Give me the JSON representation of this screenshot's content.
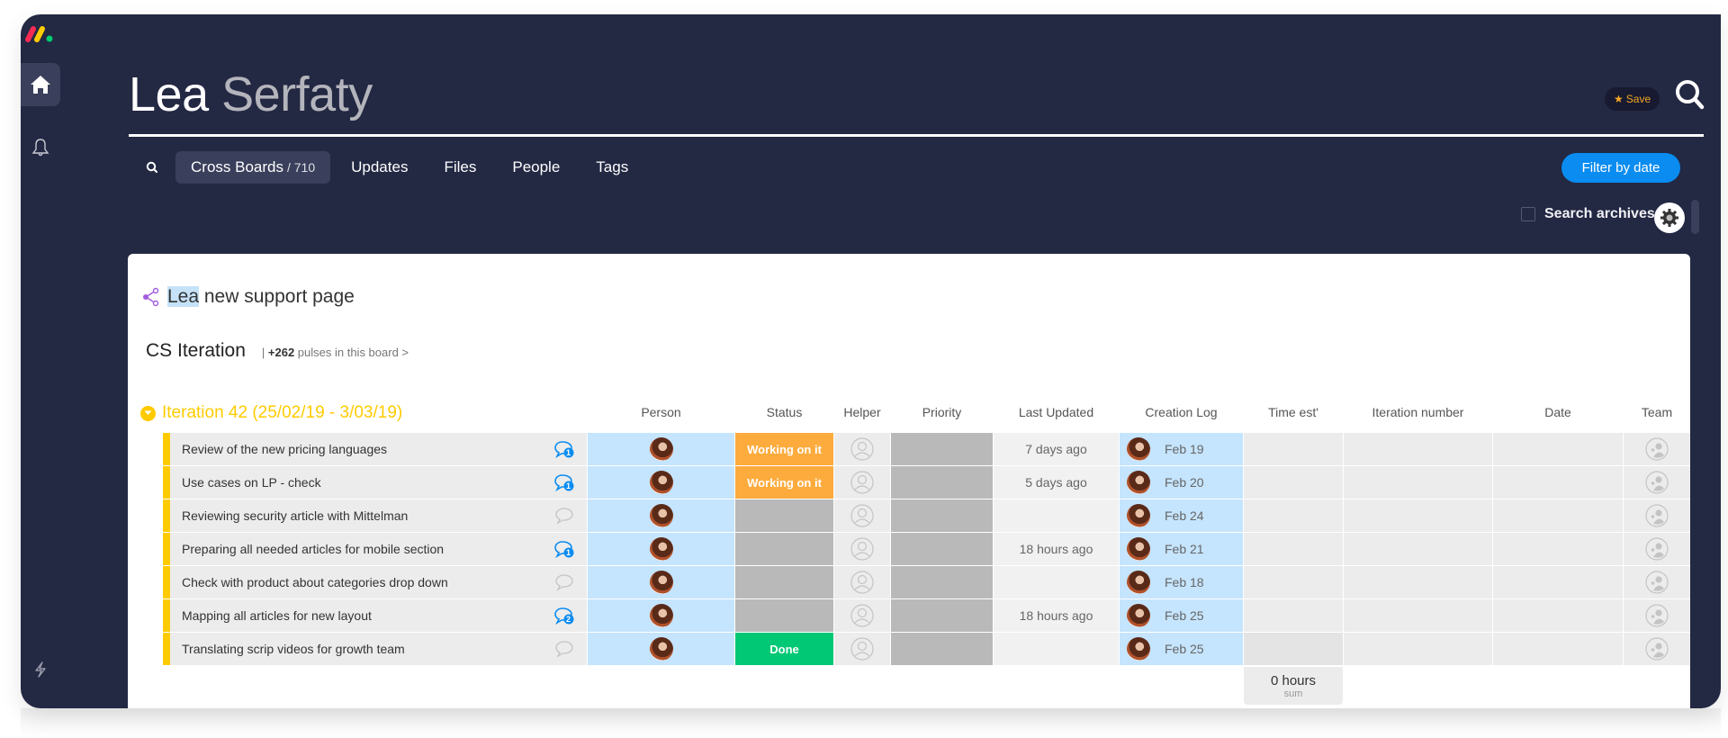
{
  "header": {
    "first_name": "Lea",
    "last_name": "Serfaty",
    "save_label": "Save"
  },
  "sidebar": {
    "items": [
      {
        "icon": "home-icon",
        "active": true
      },
      {
        "icon": "bell-icon",
        "active": false
      },
      {
        "icon": "lightning-icon",
        "active": false
      }
    ]
  },
  "tabs": [
    {
      "label": "Cross Boards",
      "count": "/ 710",
      "active": true
    },
    {
      "label": "Updates",
      "count": "",
      "active": false
    },
    {
      "label": "Files",
      "count": "",
      "active": false
    },
    {
      "label": "People",
      "count": "",
      "active": false
    },
    {
      "label": "Tags",
      "count": "",
      "active": false
    }
  ],
  "filter_label": "Filter by date",
  "search_archives_label": "Search archives",
  "pulse": {
    "highlight": "Lea",
    "rest": " new support page"
  },
  "board": {
    "name": "CS Iteration",
    "meta_prefix": "| ",
    "meta_count": "+262",
    "meta_suffix": " pulses in this board >"
  },
  "group": {
    "title": "Iteration 42 (25/02/19 - 3/03/19)",
    "color": "#ffcb00"
  },
  "columns": [
    "Person",
    "Status",
    "Helper",
    "Priority",
    "Last Updated",
    "Creation Log",
    "Time est'",
    "Iteration number",
    "Date",
    "Team"
  ],
  "rows": [
    {
      "name": "Review of the new pricing languages",
      "updates": "1",
      "status": "Working on it",
      "status_color": "#fdab3d",
      "last_updated": "7 days ago",
      "created": "Feb 19"
    },
    {
      "name": "Use cases on LP - check",
      "updates": "1",
      "status": "Working on it",
      "status_color": "#fdab3d",
      "last_updated": "5 days ago",
      "created": "Feb 20"
    },
    {
      "name": "Reviewing security article with Mittelman",
      "updates": "",
      "status": "",
      "status_color": "#b9b9b9",
      "last_updated": "",
      "created": "Feb 24"
    },
    {
      "name": "Preparing all needed articles for mobile section",
      "updates": "1",
      "status": "",
      "status_color": "#b9b9b9",
      "last_updated": "18 hours ago",
      "created": "Feb 21"
    },
    {
      "name": "Check with product about categories drop down",
      "updates": "",
      "status": "",
      "status_color": "#b9b9b9",
      "last_updated": "",
      "created": "Feb 18"
    },
    {
      "name": "Mapping all articles for new layout",
      "updates": "2",
      "status": "",
      "status_color": "#b9b9b9",
      "last_updated": "18 hours ago",
      "created": "Feb 25"
    },
    {
      "name": "Translating scrip videos for growth team",
      "updates": "",
      "status": "Done",
      "status_color": "#00c875",
      "last_updated": "",
      "created": "Feb 25"
    }
  ],
  "summary": {
    "time_est_value": "0 hours",
    "time_est_label": "sum"
  }
}
